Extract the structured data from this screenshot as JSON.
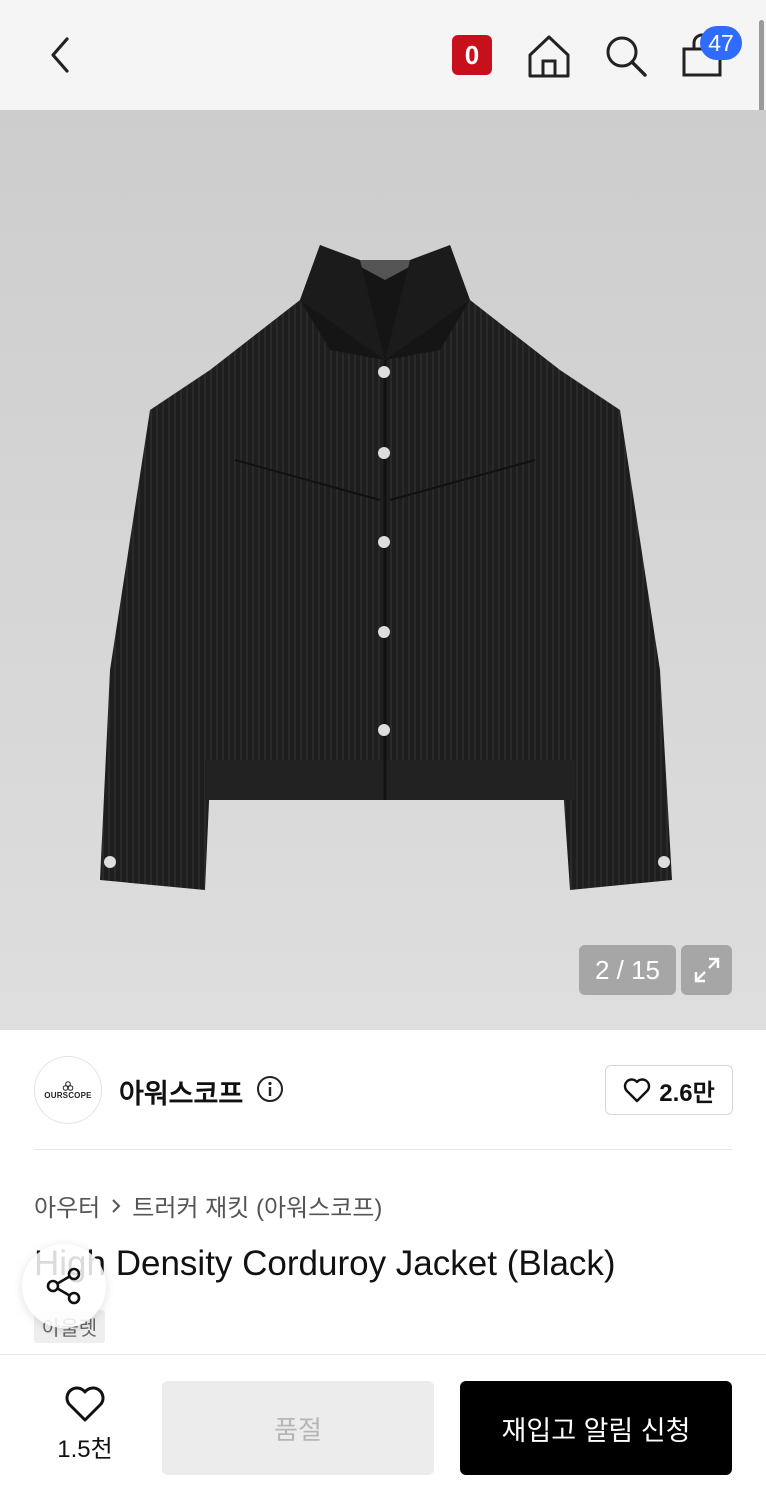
{
  "header": {
    "points_badge": "0",
    "cart_count": "47"
  },
  "gallery": {
    "counter": "2 / 15"
  },
  "brand": {
    "logo_text": "OURSCOPE",
    "name": "아워스코프",
    "like_count": "2.6만"
  },
  "product": {
    "breadcrumb": [
      "아우터",
      "트러커 재킷 (아워스코프)"
    ],
    "title": "High Density Corduroy Jacket (Black)",
    "tag": "아울렛"
  },
  "bottom": {
    "wish_count": "1.5천",
    "soldout_label": "품절",
    "restock_label": "재입고 알림 신청"
  },
  "colors": {
    "points_badge": "#c8101c",
    "cart_badge": "#2f6bff",
    "restock_button": "#000000"
  },
  "icons": [
    "back-arrow-icon",
    "home-icon",
    "search-icon",
    "shopping-bag-icon",
    "expand-icon",
    "info-icon",
    "heart-icon",
    "share-icon"
  ]
}
